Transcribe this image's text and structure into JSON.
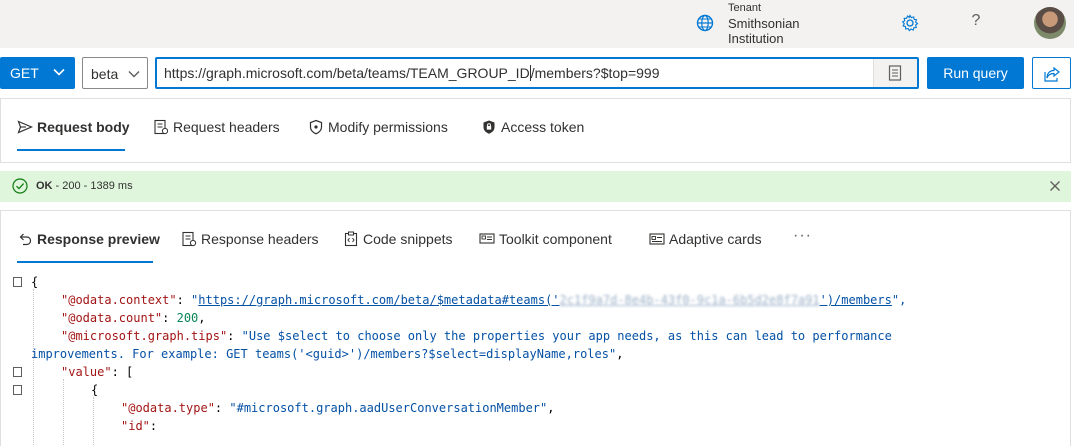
{
  "header": {
    "tenant_label": "Tenant",
    "tenant_name": "Smithsonian Institution",
    "help_glyph": "?",
    "icons": [
      "globe-icon",
      "gear-icon",
      "help-icon",
      "avatar"
    ]
  },
  "query": {
    "method": "GET",
    "version": "beta",
    "url_before_cursor": "https://graph.microsoft.com/beta/teams/TEAM_GROUP_ID",
    "url_after_cursor": "/members?$top=999",
    "run_label": "Run query"
  },
  "request_tabs": [
    {
      "label": "Request body",
      "icon": "send-icon",
      "active": true
    },
    {
      "label": "Request headers",
      "icon": "headers-icon",
      "active": false
    },
    {
      "label": "Modify permissions",
      "icon": "shield-icon",
      "active": false
    },
    {
      "label": "Access token",
      "icon": "lock-icon",
      "active": false
    }
  ],
  "status": {
    "ok": "OK",
    "detail": " - 200 - 1389 ms"
  },
  "response_tabs": [
    {
      "label": "Response preview",
      "icon": "undo-icon",
      "active": true
    },
    {
      "label": "Response headers",
      "icon": "headers-icon",
      "active": false
    },
    {
      "label": "Code snippets",
      "icon": "code-icon",
      "active": false
    },
    {
      "label": "Toolkit component",
      "icon": "toolkit-icon",
      "active": false
    },
    {
      "label": "Adaptive cards",
      "icon": "card-icon",
      "active": false
    }
  ],
  "more_label": "···",
  "response": {
    "open_brace": "{",
    "context_key": "\"@odata.context\"",
    "context_prefix": "\"",
    "context_link": "https://graph.microsoft.com/beta/$metadata#teams('",
    "context_redacted": "2c1f9a7d-8e4b-43f0-9c1a-6b5d2e8f7a91",
    "context_link_end": "')/members",
    "context_suffix": "\",",
    "count_key": "\"@odata.count\"",
    "count_value": "200",
    "tips_key": "\"@microsoft.graph.tips\"",
    "tips_line1": "\"Use $select to choose only the properties your app needs, as this can lead to performance",
    "tips_line2": "improvements. For example: GET teams('<guid>')/members?$select=displayName,roles\"",
    "value_key": "\"value\"",
    "value_open": "[",
    "item_open": "{",
    "type_key": "\"@odata.type\"",
    "type_value": "\"#microsoft.graph.aadUserConversationMember\"",
    "id_key": "\"id\""
  },
  "colors": {
    "accent": "#0078d4",
    "status_bg": "#dff6dd",
    "status_icon": "#107c10",
    "json_key": "#a31515",
    "json_string": "#0451a5",
    "json_number": "#098658"
  }
}
